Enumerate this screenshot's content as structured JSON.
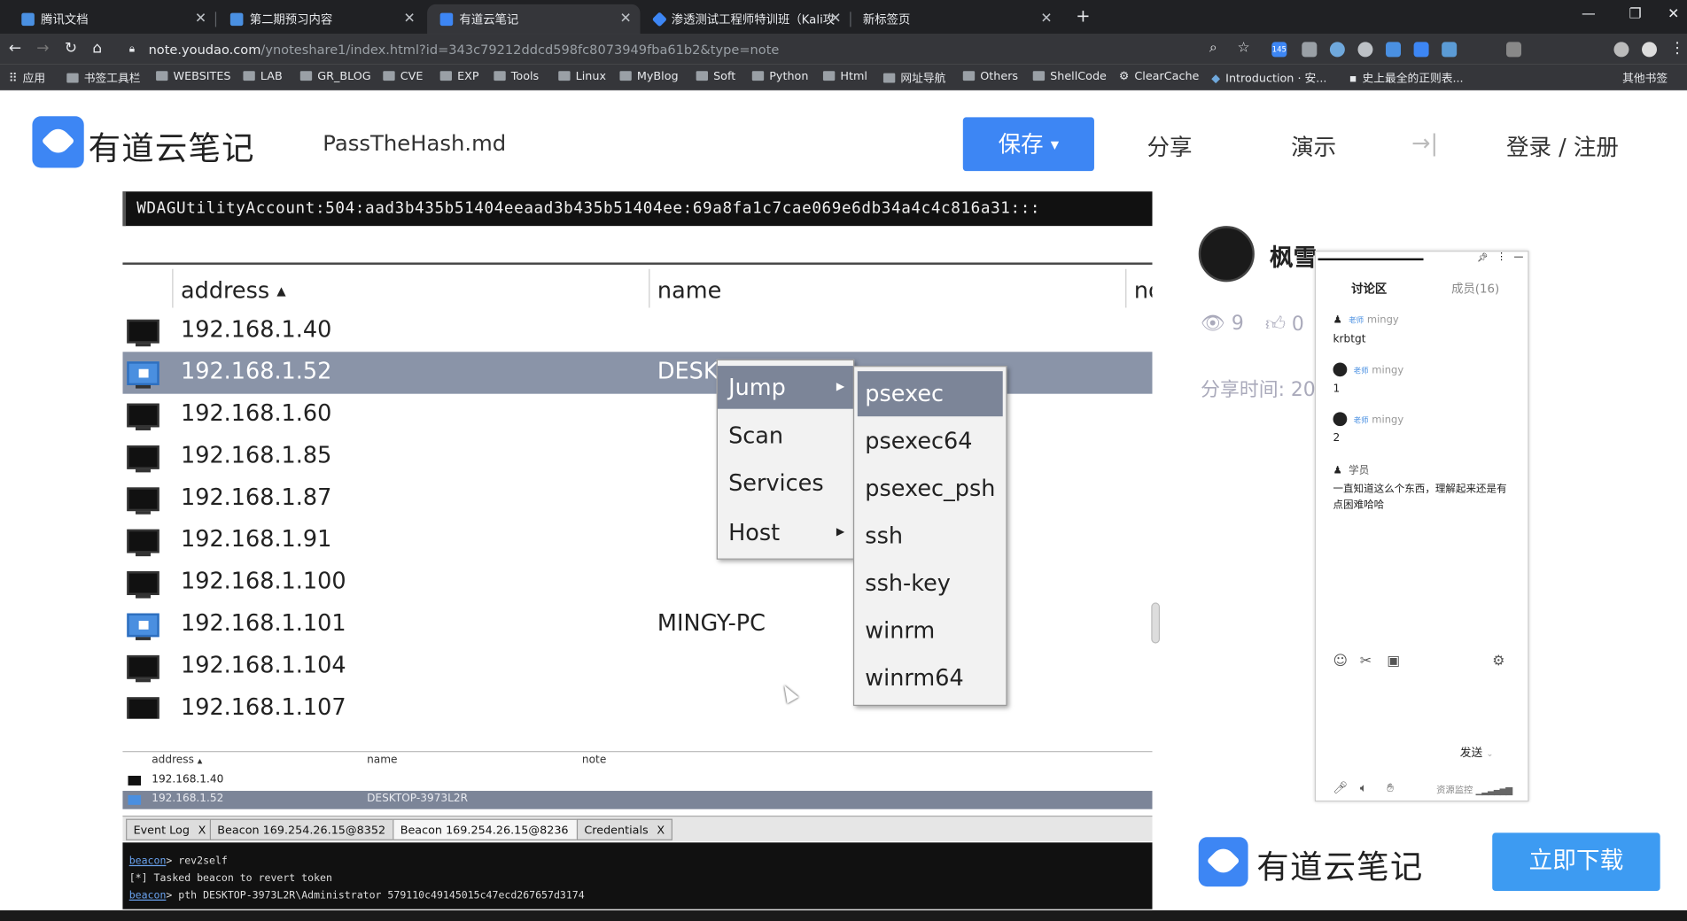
{
  "browser": {
    "tabs": [
      {
        "label": "腾讯文档",
        "color": "#4a90e2"
      },
      {
        "label": "第二期预习内容",
        "color": "#4a90e2"
      },
      {
        "label": "有道云笔记",
        "color": "#3d86f4"
      },
      {
        "label": "渗透测试工程师特训班（Kali攻",
        "color": "#3d86f4"
      },
      {
        "label": "新标签页",
        "color": "#888888"
      }
    ],
    "new_tab": "+",
    "url_host": "note.youdao.com",
    "url_rest": "/ynoteshare1/index.html?id=343c79212ddcd598fc8073949fba61b2&type=note",
    "ext_badge": "145",
    "bookmarks": [
      "应用",
      "书签工具栏",
      "WEBSITES",
      "LAB",
      "GR_BLOG",
      "CVE",
      "EXP",
      "Tools",
      "Linux",
      "MyBlog",
      "Soft",
      "Python",
      "Html",
      "网址导航",
      "Others",
      "ShellCode",
      "ClearCache",
      "Introduction · 安...",
      "史上最全的正则表...",
      "其他书签"
    ]
  },
  "header": {
    "logo_text": "有道云笔记",
    "doc_title": "PassTheHash.md",
    "save_label": "保存",
    "share_label": "分享",
    "present_label": "演示",
    "expand_icon": "→|",
    "login_label": "登录 / 注册"
  },
  "note": {
    "hash_line": "WDAGUtilityAccount:504:aad3b435b51404eeaad3b435b51404ee:69a8fa1c7cae069e6db34a4c4c816a31:::",
    "table": {
      "col_address": "address",
      "col_name": "name",
      "col_note": "no",
      "rows": [
        {
          "ip": "192.168.1.40",
          "name": "",
          "win": false,
          "selected": false
        },
        {
          "ip": "192.168.1.52",
          "name": "DESK",
          "win": true,
          "selected": true
        },
        {
          "ip": "192.168.1.60",
          "name": "",
          "win": false,
          "selected": false
        },
        {
          "ip": "192.168.1.85",
          "name": "",
          "win": false,
          "selected": false
        },
        {
          "ip": "192.168.1.87",
          "name": "",
          "win": false,
          "selected": false
        },
        {
          "ip": "192.168.1.91",
          "name": "",
          "win": false,
          "selected": false
        },
        {
          "ip": "192.168.1.100",
          "name": "",
          "win": false,
          "selected": false
        },
        {
          "ip": "192.168.1.101",
          "name": "MINGY-PC",
          "win": true,
          "selected": false
        },
        {
          "ip": "192.168.1.104",
          "name": "",
          "win": false,
          "selected": false
        },
        {
          "ip": "192.168.1.107",
          "name": "",
          "win": false,
          "selected": false
        }
      ]
    },
    "context_menu": [
      "Jump",
      "Scan",
      "Services",
      "Host"
    ],
    "submenu": [
      "psexec",
      "psexec64",
      "psexec_psh",
      "ssh",
      "ssh-key",
      "winrm",
      "winrm64"
    ],
    "small_table": {
      "col_address": "address",
      "col_name": "name",
      "col_note": "note",
      "rows": [
        {
          "ip": "192.168.1.40",
          "name": "",
          "selected": false
        },
        {
          "ip": "192.168.1.52",
          "name": "DESKTOP-3973L2R",
          "selected": true
        }
      ]
    },
    "bottom_tabs": [
      "Event Log",
      "Beacon 169.254.26.15@8352",
      "Beacon 169.254.26.15@8236",
      "Credentials"
    ],
    "console": [
      {
        "prompt": "beacon",
        "text": "> rev2self"
      },
      {
        "prompt": "",
        "text": "[*] Tasked beacon to revert token"
      },
      {
        "prompt": "beacon",
        "text": "> pth DESKTOP-3973L2R\\Administrator 579110c49145015c47ecd267657d3174"
      }
    ]
  },
  "author": {
    "name": "枫雪",
    "views": "9",
    "likes": "0",
    "share_time": "分享时间: 20"
  },
  "chat": {
    "tab_discuss": "讨论区",
    "tab_members": "成员(16)",
    "messages": [
      {
        "role": "老师",
        "user": "mingy",
        "text": "krbtgt"
      },
      {
        "role": "老师",
        "user": "mingy",
        "text": "1"
      },
      {
        "role": "老师",
        "user": "mingy",
        "text": "2"
      },
      {
        "role": "",
        "user": "学员",
        "text": "一直知道这么个东西，理解起来还是有点困难哈哈"
      }
    ],
    "send_label": "发送",
    "resource_label": "资源监控"
  },
  "download": {
    "logo_text": "有道云笔记",
    "button_label": "立即下载"
  },
  "colors": {
    "accent": "#3d86f4",
    "selection": "#7c8598"
  }
}
